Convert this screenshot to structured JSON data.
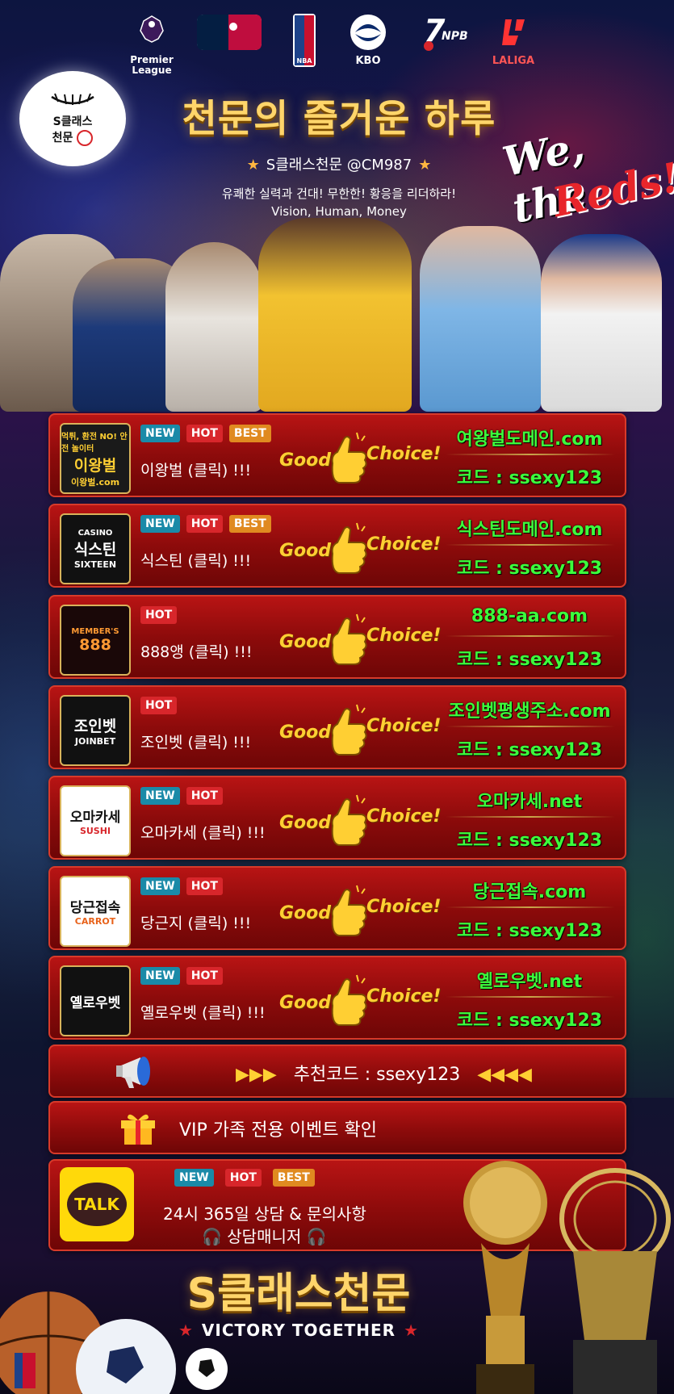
{
  "header": {
    "leagues": [
      {
        "name": "Premier League",
        "label": "Premier\nLeague"
      },
      {
        "name": "MLB",
        "label": ""
      },
      {
        "name": "NBA",
        "label": "NBA"
      },
      {
        "name": "KBO",
        "label": "KBO"
      },
      {
        "name": "NPB",
        "label": "NPB"
      },
      {
        "name": "LALIGA",
        "label": "LALIGA"
      }
    ],
    "logo_line1": "S클래스",
    "logo_line2": "천문",
    "title": "천문의 즐거운 하루",
    "subtitle": "S클래스천문 @CM987",
    "motto1": "유쾌한 실력과 건대! 무한한! 황응을 리더하라!",
    "motto2": "Vision, Human, Money",
    "slogan1": "We, the",
    "slogan2": "Reds!"
  },
  "sites": [
    {
      "logo": "이왕벌",
      "logo_sub": "먹튀, 환전 NO! 안전 놀이터",
      "logo_foot": "이왕벌.com",
      "badges": [
        "NEW",
        "HOT",
        "BEST"
      ],
      "name": "이왕벌 (클릭) !!!",
      "domain": "여왕벌도메인.com",
      "code": "코드 : ssexy123"
    },
    {
      "logo": "식스틴",
      "logo_sub": "CASINO",
      "logo_foot": "SIXTEEN",
      "badges": [
        "NEW",
        "HOT",
        "BEST"
      ],
      "name": "식스틴 (클릭) !!!",
      "domain": "식스틴도메인.com",
      "code": "코드 : ssexy123"
    },
    {
      "logo": "888",
      "logo_sub": "MEMBER'S",
      "logo_foot": "",
      "badges": [
        "HOT"
      ],
      "name": "888앵 (클릭) !!!",
      "domain": "888-aa.com",
      "code": "코드 : ssexy123"
    },
    {
      "logo": "조인벳",
      "logo_sub": "",
      "logo_foot": "JOINBET",
      "badges": [
        "HOT"
      ],
      "name": "조인벳 (클릭) !!!",
      "domain": "조인벳평생주소.com",
      "code": "코드 : ssexy123"
    },
    {
      "logo": "오마카세",
      "logo_sub": "",
      "logo_foot": "SUSHI",
      "badges": [
        "NEW",
        "HOT"
      ],
      "name": "오마카세 (클릭) !!!",
      "domain": "오마카세.net",
      "code": "코드 : ssexy123"
    },
    {
      "logo": "당근접속",
      "logo_sub": "",
      "logo_foot": "CARROT",
      "badges": [
        "NEW",
        "HOT"
      ],
      "name": "당근지 (클릭) !!!",
      "domain": "당근접속.com",
      "code": "코드 : ssexy123"
    },
    {
      "logo": "옐로우벳",
      "logo_sub": "",
      "logo_foot": "",
      "badges": [
        "NEW",
        "HOT"
      ],
      "name": "옐로우벳 (클릭) !!!",
      "domain": "옐로우벳.net",
      "code": "코드 : ssexy123"
    }
  ],
  "good": "Good",
  "choice": "Choice!",
  "recommend": {
    "arrows_right": "▶▶▶",
    "text": "추천코드 : ssexy123",
    "arrows_left": "◀◀◀◀"
  },
  "vip": "VIP 가족 전용 이벤트 확인",
  "contact": {
    "talk": "TALK",
    "badges": [
      "NEW",
      "HOT",
      "BEST"
    ],
    "line1": "24시 365일 상담 & 문의사항",
    "line2": "상담매니저"
  },
  "footer": {
    "brand": "S클래스천문",
    "tagline": "VICTORY TOGETHER"
  },
  "colors": {
    "accent_gold": "#ffd56a",
    "row_red": "#b81414",
    "domain_green": "#3cff3c",
    "badge_new": "#1a8aa8",
    "badge_hot": "#d8262b",
    "badge_best": "#e08a20"
  }
}
